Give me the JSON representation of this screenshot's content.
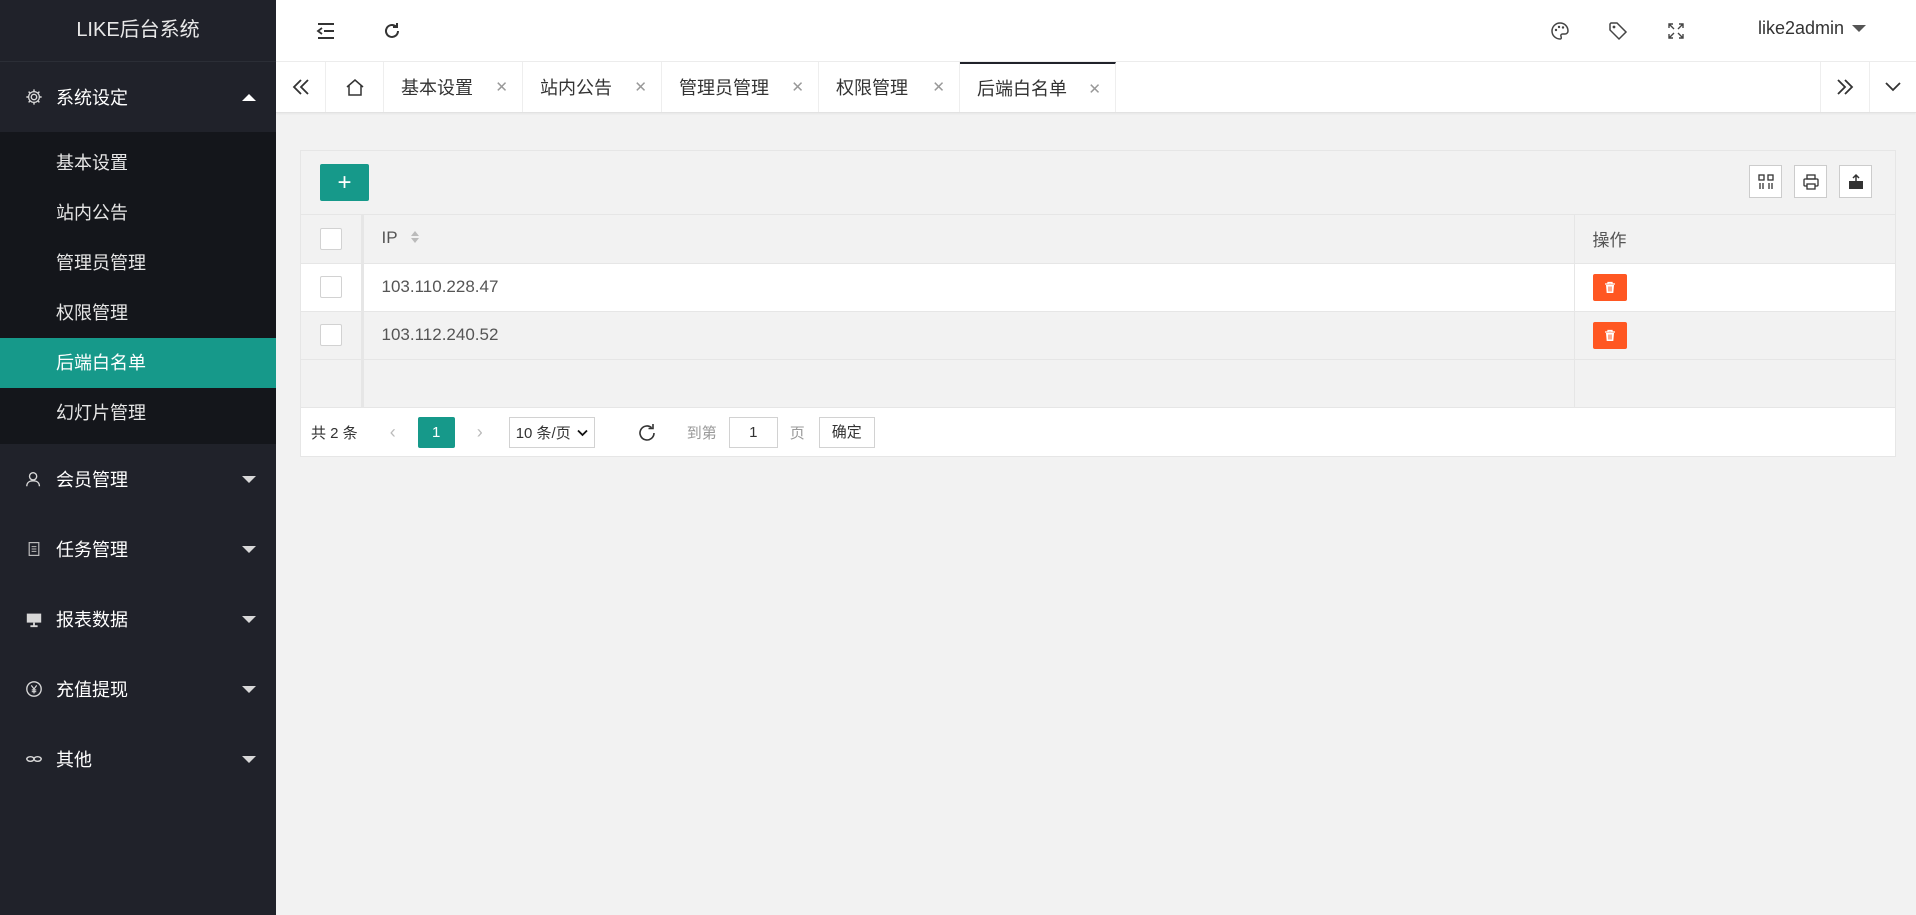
{
  "app": {
    "title": "LIKE后台系统"
  },
  "sidebar": {
    "groups": [
      {
        "label": "系统设定",
        "icon": "gear-icon",
        "expanded": true,
        "items": [
          "基本设置",
          "站内公告",
          "管理员管理",
          "权限管理",
          "后端白名单",
          "幻灯片管理"
        ],
        "active_item": "后端白名单"
      },
      {
        "label": "会员管理",
        "icon": "user-icon",
        "expanded": false
      },
      {
        "label": "任务管理",
        "icon": "document-icon",
        "expanded": false
      },
      {
        "label": "报表数据",
        "icon": "monitor-icon",
        "expanded": false
      },
      {
        "label": "充值提现",
        "icon": "yen-icon",
        "expanded": false
      },
      {
        "label": "其他",
        "icon": "link-icon",
        "expanded": false
      }
    ]
  },
  "header": {
    "icons": [
      "collapse-menu-icon",
      "refresh-icon",
      "palette-icon",
      "tag-icon",
      "fullscreen-icon"
    ],
    "username": "like2admin"
  },
  "tabs": {
    "items": [
      "基本设置",
      "站内公告",
      "管理员管理",
      "权限管理",
      "后端白名单"
    ],
    "active": "后端白名单",
    "close_glyph": "✕"
  },
  "toolbar": {
    "add_label": "+"
  },
  "table": {
    "columns": {
      "ip": "IP",
      "ops": "操作"
    },
    "rows": [
      {
        "ip": "103.110.228.47"
      },
      {
        "ip": "103.112.240.52"
      }
    ]
  },
  "pager": {
    "total_text": "共 2 条",
    "prev": "‹",
    "next": "›",
    "current_page": "1",
    "page_size": "10 条/页",
    "goto_label": "到第",
    "goto_value": "1",
    "page_unit": "页",
    "confirm": "确定"
  },
  "colors": {
    "accent": "#16998a",
    "danger": "#ff5722",
    "sidebar_bg": "#20222a"
  }
}
